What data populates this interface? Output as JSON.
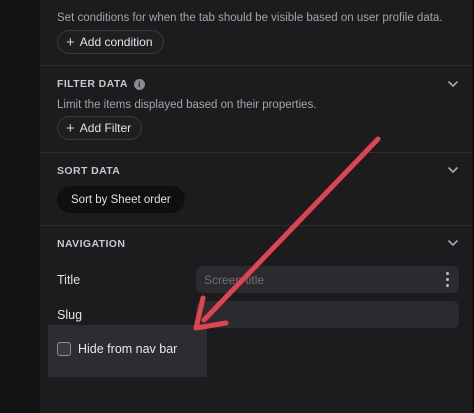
{
  "visibility": {
    "hint": "Set conditions for when the tab should be visible based on user profile data.",
    "add_condition_label": "Add condition",
    "plus_icon": "plus-icon"
  },
  "filter_data": {
    "title": "FILTER DATA",
    "info_icon": "info-icon",
    "info_glyph": "i",
    "hint": "Limit the items displayed based on their properties.",
    "add_filter_label": "Add Filter"
  },
  "sort_data": {
    "title": "SORT DATA",
    "sort_button_label": "Sort by Sheet order"
  },
  "navigation": {
    "title": "NAVIGATION",
    "title_label": "Title",
    "title_placeholder": "Screen title",
    "slug_label": "Slug",
    "slug_value": "",
    "hide_from_nav_label": "Hide from nav bar",
    "hide_from_nav_checked": false
  },
  "annotation": {
    "arrow_color": "#e0444f"
  },
  "colors": {
    "panel_background": "#1c1c1e",
    "input_background": "#2b2b2f",
    "accent_arrow": "#e0444f"
  }
}
